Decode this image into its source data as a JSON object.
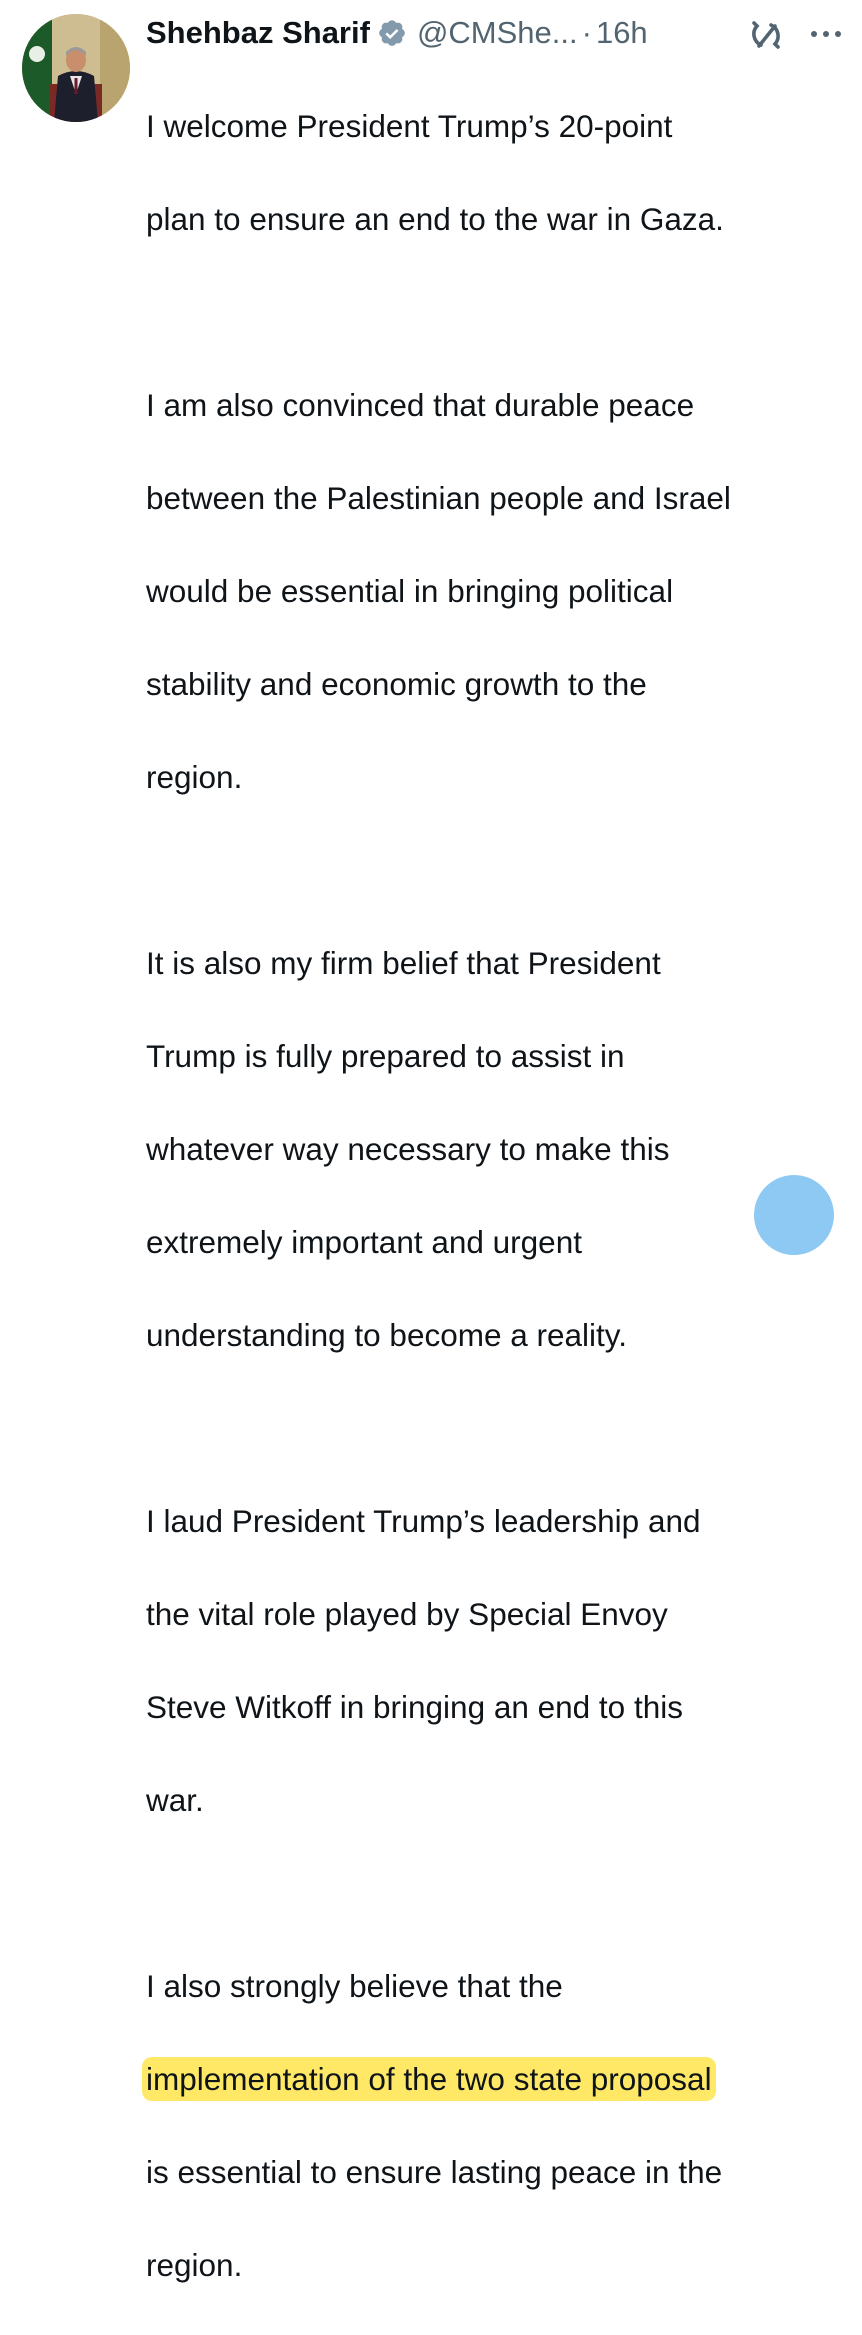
{
  "author": {
    "name": "Shehbaz Sharif",
    "handle": "@CMShe...",
    "separator": "·",
    "time": "16h"
  },
  "icons": {
    "verified": "verified-badge-icon",
    "grok": "grok-icon",
    "more": "more-options-icon"
  },
  "colors": {
    "verified_badge": "#829aab",
    "highlight": "#ffe866",
    "fab": "#8ec9f3",
    "text": "#0f1419",
    "secondary_text": "#536471"
  },
  "tweet": {
    "p1": {
      "l1": "I welcome President Trump’s 20-point",
      "l2": "plan to ensure an end to the war in Gaza."
    },
    "p2": {
      "l1": "I am also convinced that durable peace",
      "l2": "between the Palestinian people and Israel",
      "l3": "would be essential in bringing political",
      "l4": "stability and economic growth to the",
      "l5": "region."
    },
    "p3": {
      "l1": "It is also my firm belief that President",
      "l2": "Trump is fully prepared to assist in",
      "l3": "whatever way necessary to make this",
      "l4": "extremely important and urgent",
      "l5": "understanding to become a reality."
    },
    "p4": {
      "l1": "I laud President Trump’s leadership and",
      "l2": "the vital role played by Special Envoy",
      "l3": "Steve Witkoff in bringing an end to this",
      "l4": "war."
    },
    "p5": {
      "l1": "I also strongly believe that the",
      "l2_highlighted": "implementation of the two state proposal",
      "l3": "is essential to ensure lasting peace in the",
      "l4": "region."
    }
  }
}
